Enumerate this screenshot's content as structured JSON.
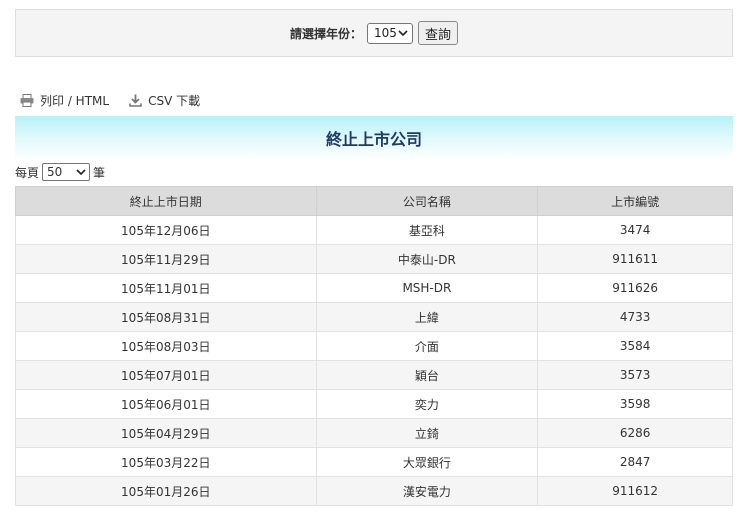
{
  "filter": {
    "label": "請選擇年份：",
    "year": "105",
    "button": "查詢"
  },
  "toolbar": {
    "print_label": "列印 / HTML",
    "csv_label": "CSV 下載"
  },
  "title": "終止上市公司",
  "pager": {
    "prefix": "每頁",
    "page_size": "50",
    "suffix": "筆"
  },
  "table": {
    "headers": [
      "終止上市日期",
      "公司名稱",
      "上市編號"
    ],
    "rows": [
      [
        "105年12月06日",
        "基亞科",
        "3474"
      ],
      [
        "105年11月29日",
        "中泰山-DR",
        "911611"
      ],
      [
        "105年11月01日",
        "MSH-DR",
        "911626"
      ],
      [
        "105年08月31日",
        "上緯",
        "4733"
      ],
      [
        "105年08月03日",
        "介面",
        "3584"
      ],
      [
        "105年07月01日",
        "穎台",
        "3573"
      ],
      [
        "105年06月01日",
        "奕力",
        "3598"
      ],
      [
        "105年04月29日",
        "立錡",
        "6286"
      ],
      [
        "105年03月22日",
        "大眾銀行",
        "2847"
      ],
      [
        "105年01月26日",
        "漢安電力",
        "911612"
      ]
    ]
  }
}
